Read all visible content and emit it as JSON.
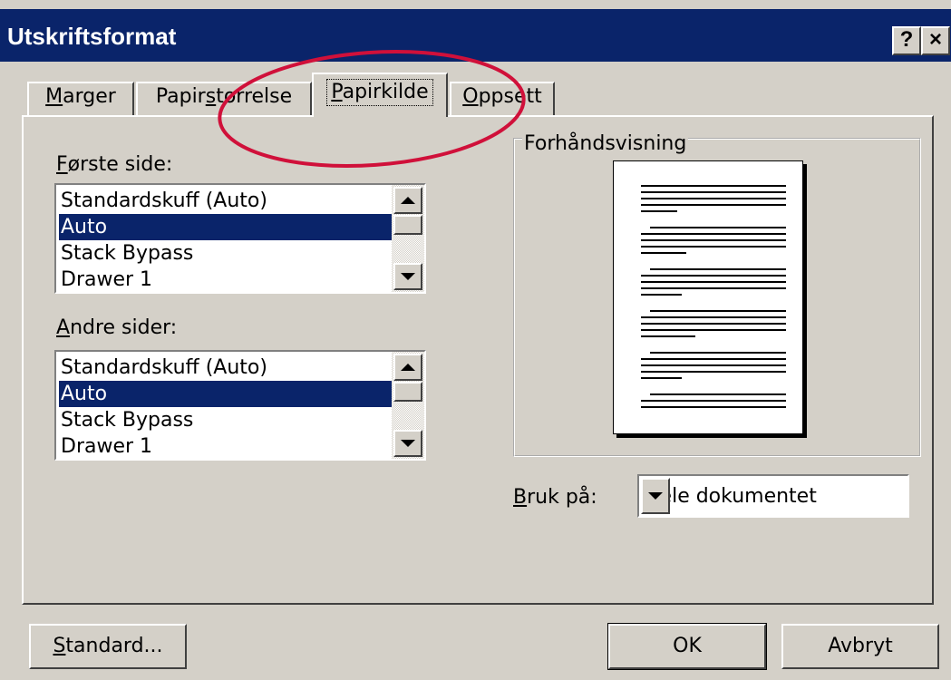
{
  "window": {
    "title": "Utskriftsformat",
    "help_button": "?",
    "close_button": "×"
  },
  "tabs": [
    {
      "pre": "",
      "key": "M",
      "post": "arger"
    },
    {
      "pre": "Papir",
      "key": "s",
      "post": "tørrelse"
    },
    {
      "pre": "",
      "key": "P",
      "post": "apirkilde",
      "active": true
    },
    {
      "pre": "",
      "key": "O",
      "post": "ppsett"
    }
  ],
  "first_page": {
    "label_key": "F",
    "label_rest": "ørste side:",
    "items": [
      "Standardskuff (Auto)",
      "Auto",
      "Stack Bypass",
      "Drawer 1"
    ],
    "selected": "Auto"
  },
  "other_pages": {
    "label_key": "A",
    "label_rest": "ndre sider:",
    "items": [
      "Standardskuff (Auto)",
      "Auto",
      "Stack Bypass",
      "Drawer 1"
    ],
    "selected": "Auto"
  },
  "preview": {
    "title": "Forhåndsvisning"
  },
  "apply_to": {
    "label_key": "B",
    "label_rest": "ruk på:",
    "value": "Hele dokumentet"
  },
  "buttons": {
    "default_key": "S",
    "default_rest": "tandard...",
    "ok": "OK",
    "cancel": "Avbryt"
  },
  "colors": {
    "titlebar": "#0a246a",
    "dialog_bg": "#d4d0c8",
    "selection": "#0a246a",
    "annotation_ellipse": "#d0103a"
  }
}
